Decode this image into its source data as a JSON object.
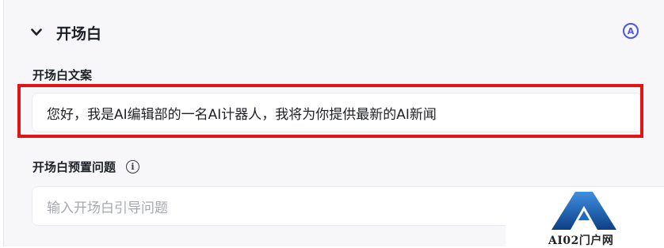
{
  "header": {
    "title": "开场白",
    "auto_icon_text": "A"
  },
  "opening_text": {
    "label": "开场白文案",
    "value": "您好，我是AI编辑部的一名AI计器人，我将为你提供最新的AI新闻"
  },
  "preset_questions": {
    "label": "开场白预置问题",
    "info_icon_text": "i",
    "placeholder": "输入开场白引导问题"
  },
  "watermark": {
    "text": "AI02门户网"
  },
  "colors": {
    "accent": "#4d53e8",
    "highlight": "#e11515",
    "panel_bg": "#f7f7fa"
  }
}
